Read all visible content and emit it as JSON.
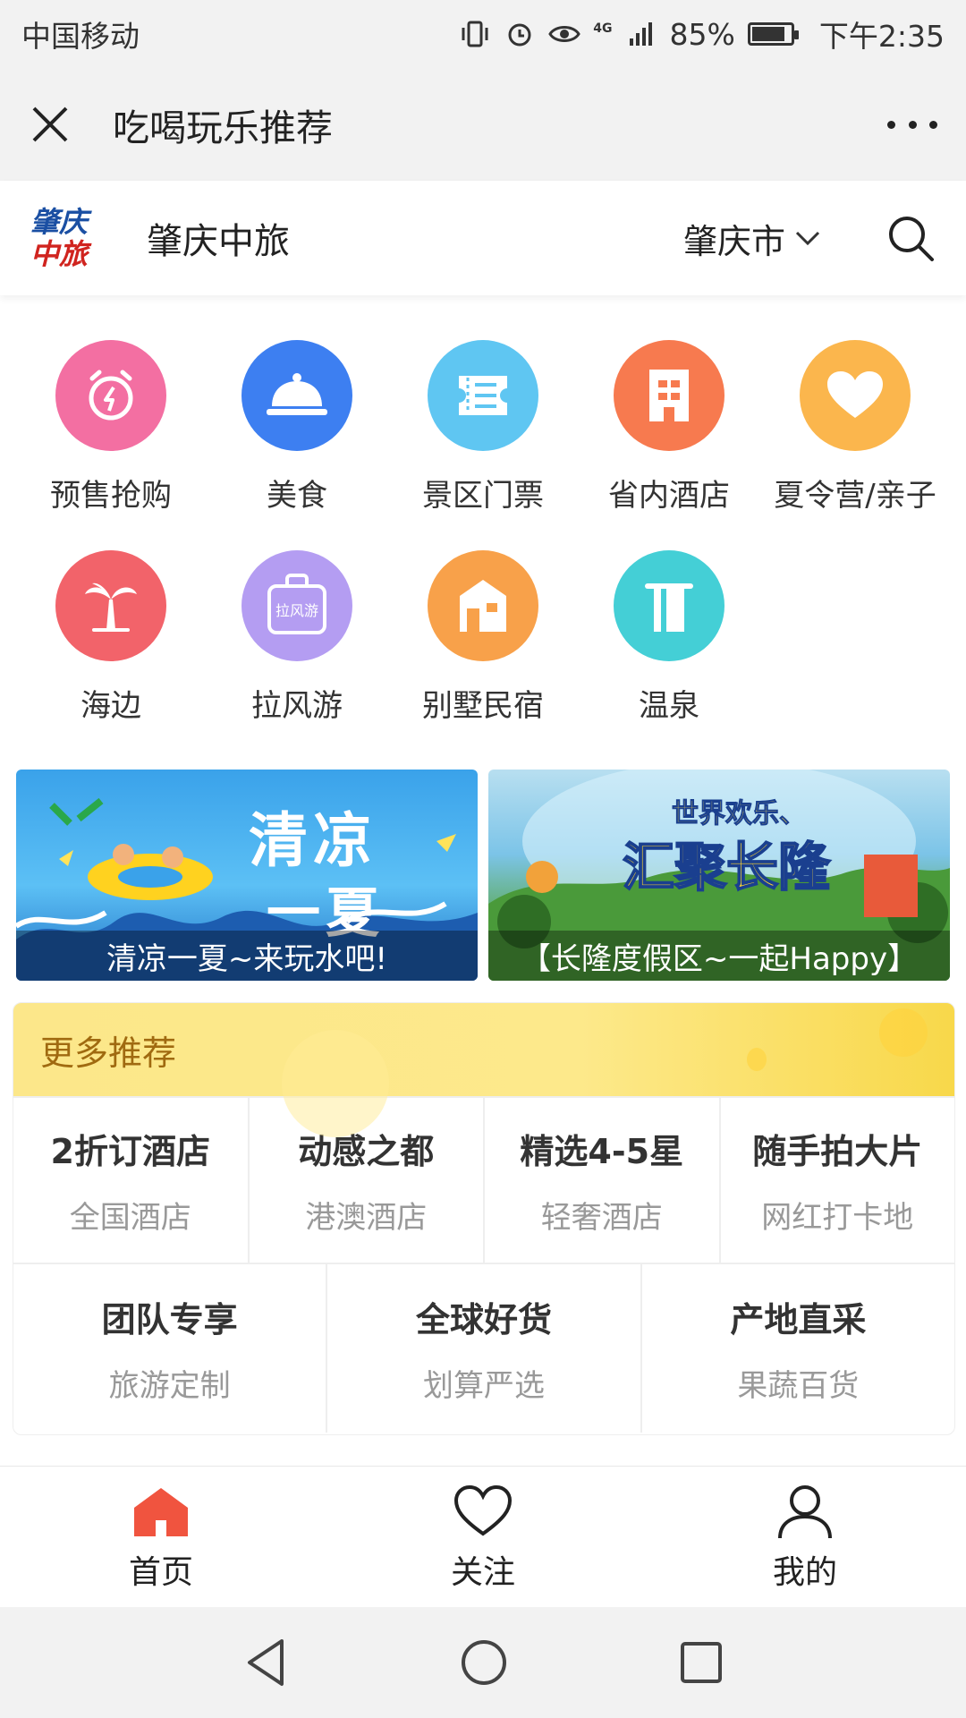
{
  "status_bar": {
    "carrier": "中国移动",
    "network": "4G",
    "battery": "85%",
    "time": "下午2:35"
  },
  "title_bar": {
    "title": "吃喝玩乐推荐"
  },
  "brand": {
    "logo_line1": "肇庆",
    "logo_line2": "中旅",
    "name": "肇庆中旅",
    "city": "肇庆市"
  },
  "categories": [
    {
      "label": "预售抢购",
      "icon": "alarm-icon",
      "color": "#f36fa2"
    },
    {
      "label": "美食",
      "icon": "food-cloche-icon",
      "color": "#3d7ff1"
    },
    {
      "label": "景区门票",
      "icon": "ticket-icon",
      "color": "#5fc6f2"
    },
    {
      "label": "省内酒店",
      "icon": "hotel-building-icon",
      "color": "#f77a4f"
    },
    {
      "label": "夏令营/亲子",
      "icon": "heart-icon",
      "color": "#fbb64d"
    },
    {
      "label": "海边",
      "icon": "palm-tree-icon",
      "color": "#f2636a"
    },
    {
      "label": "拉风游",
      "icon": "luggage-icon",
      "color": "#b49df2",
      "badge_text": "拉风游"
    },
    {
      "label": "别墅民宿",
      "icon": "house-icon",
      "color": "#f8a14a"
    },
    {
      "label": "温泉",
      "icon": "towel-icon",
      "color": "#44cfd6"
    }
  ],
  "banners": [
    {
      "caption": "清凉一夏~来玩水吧!",
      "art_text_1": "清凉",
      "art_text_2": "一夏"
    },
    {
      "caption": "【长隆度假区~一起Happy】",
      "art_text_1": "世界欢乐、",
      "art_text_2": "汇聚长隆"
    }
  ],
  "recommendations": {
    "header": "更多推荐",
    "row1": [
      {
        "title": "2折订酒店",
        "subtitle": "全国酒店"
      },
      {
        "title": "动感之都",
        "subtitle": "港澳酒店"
      },
      {
        "title": "精选4-5星",
        "subtitle": "轻奢酒店"
      },
      {
        "title": "随手拍大片",
        "subtitle": "网红打卡地"
      }
    ],
    "row2": [
      {
        "title": "团队专享",
        "subtitle": "旅游定制"
      },
      {
        "title": "全球好货",
        "subtitle": "划算严选"
      },
      {
        "title": "产地直采",
        "subtitle": "果蔬百货"
      }
    ]
  },
  "tabs": [
    {
      "label": "首页",
      "icon": "home-icon",
      "active": true
    },
    {
      "label": "关注",
      "icon": "heart-outline-icon",
      "active": false
    },
    {
      "label": "我的",
      "icon": "user-icon",
      "active": false
    }
  ],
  "colors": {
    "accent_home": "#f0543f",
    "rec_header_text": "#a06a10"
  }
}
